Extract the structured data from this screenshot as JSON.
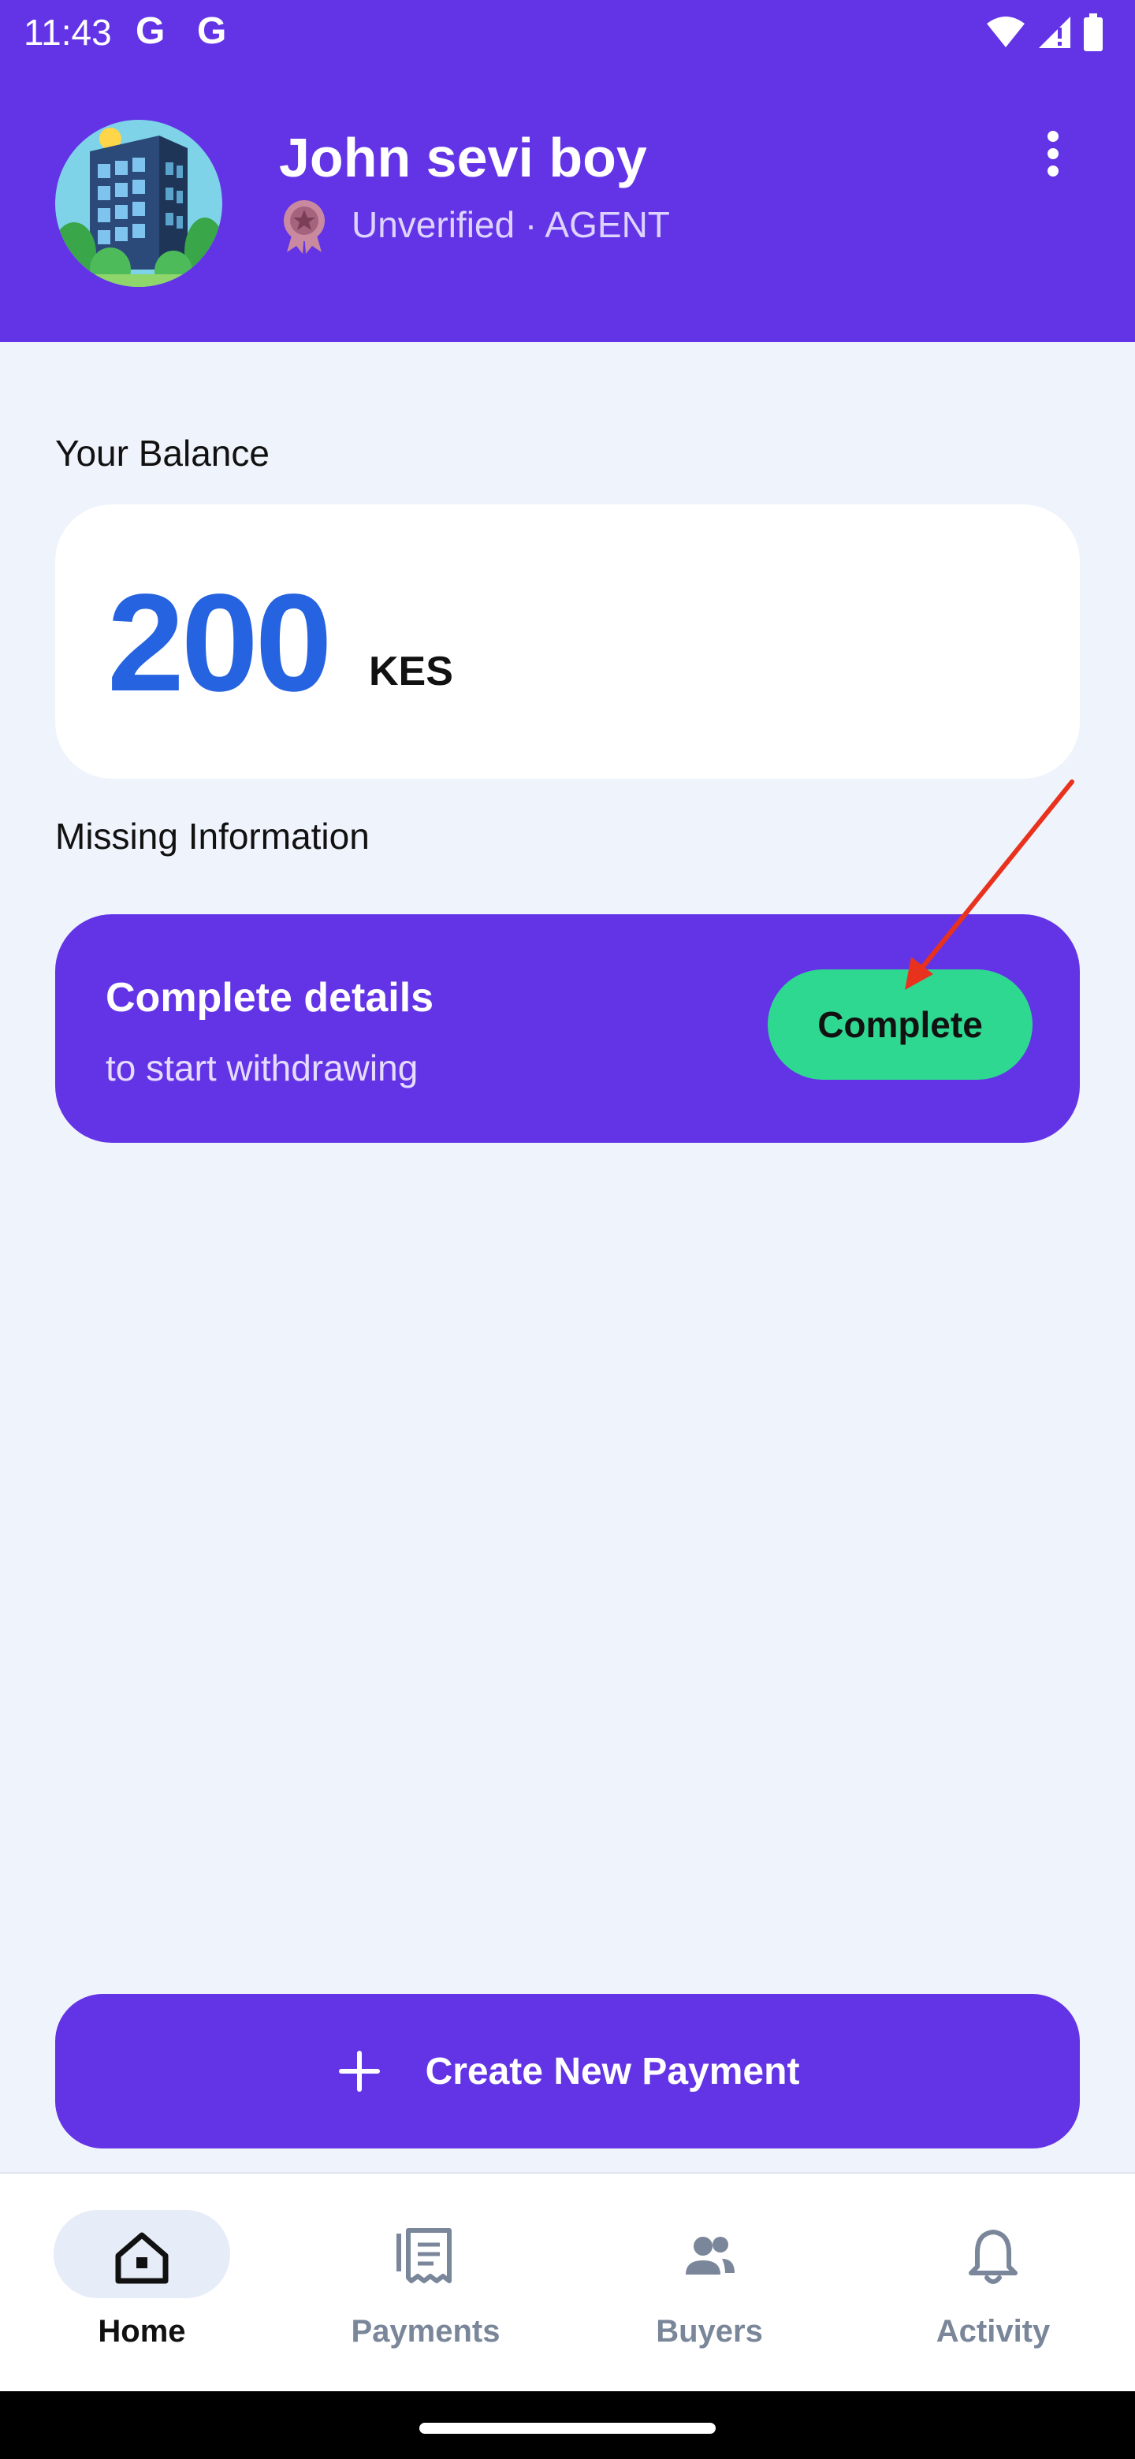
{
  "status_bar": {
    "time": "11:43",
    "notification_icons": [
      "G",
      "G"
    ],
    "right_icons": [
      "wifi-icon",
      "cellular-signal-icon",
      "battery-icon"
    ]
  },
  "profile": {
    "name": "John sevi boy",
    "role": "Unverified · AGENT",
    "badge_icon": "award-badge-icon",
    "avatar": "building-avatar"
  },
  "balance": {
    "label": "Your Balance",
    "value": "200",
    "currency": "KES"
  },
  "missing_info": {
    "label": "Missing Information",
    "title": "Complete details",
    "subtitle": "to start withdrawing",
    "button_label": "Complete"
  },
  "create_payment": {
    "label": "Create New Payment",
    "icon": "plus-icon"
  },
  "bottom_nav": {
    "items": [
      {
        "label": "Home",
        "icon": "home-icon",
        "active": true
      },
      {
        "label": "Payments",
        "icon": "receipt-icon",
        "active": false
      },
      {
        "label": "Buyers",
        "icon": "people-icon",
        "active": false
      },
      {
        "label": "Activity",
        "icon": "bell-icon",
        "active": false
      }
    ]
  },
  "colors": {
    "primary": "#6334e6",
    "accent_green": "#2fd891",
    "balance_blue": "#2563e0",
    "background": "#eff3fb",
    "annotation_arrow": "#e8321e"
  }
}
